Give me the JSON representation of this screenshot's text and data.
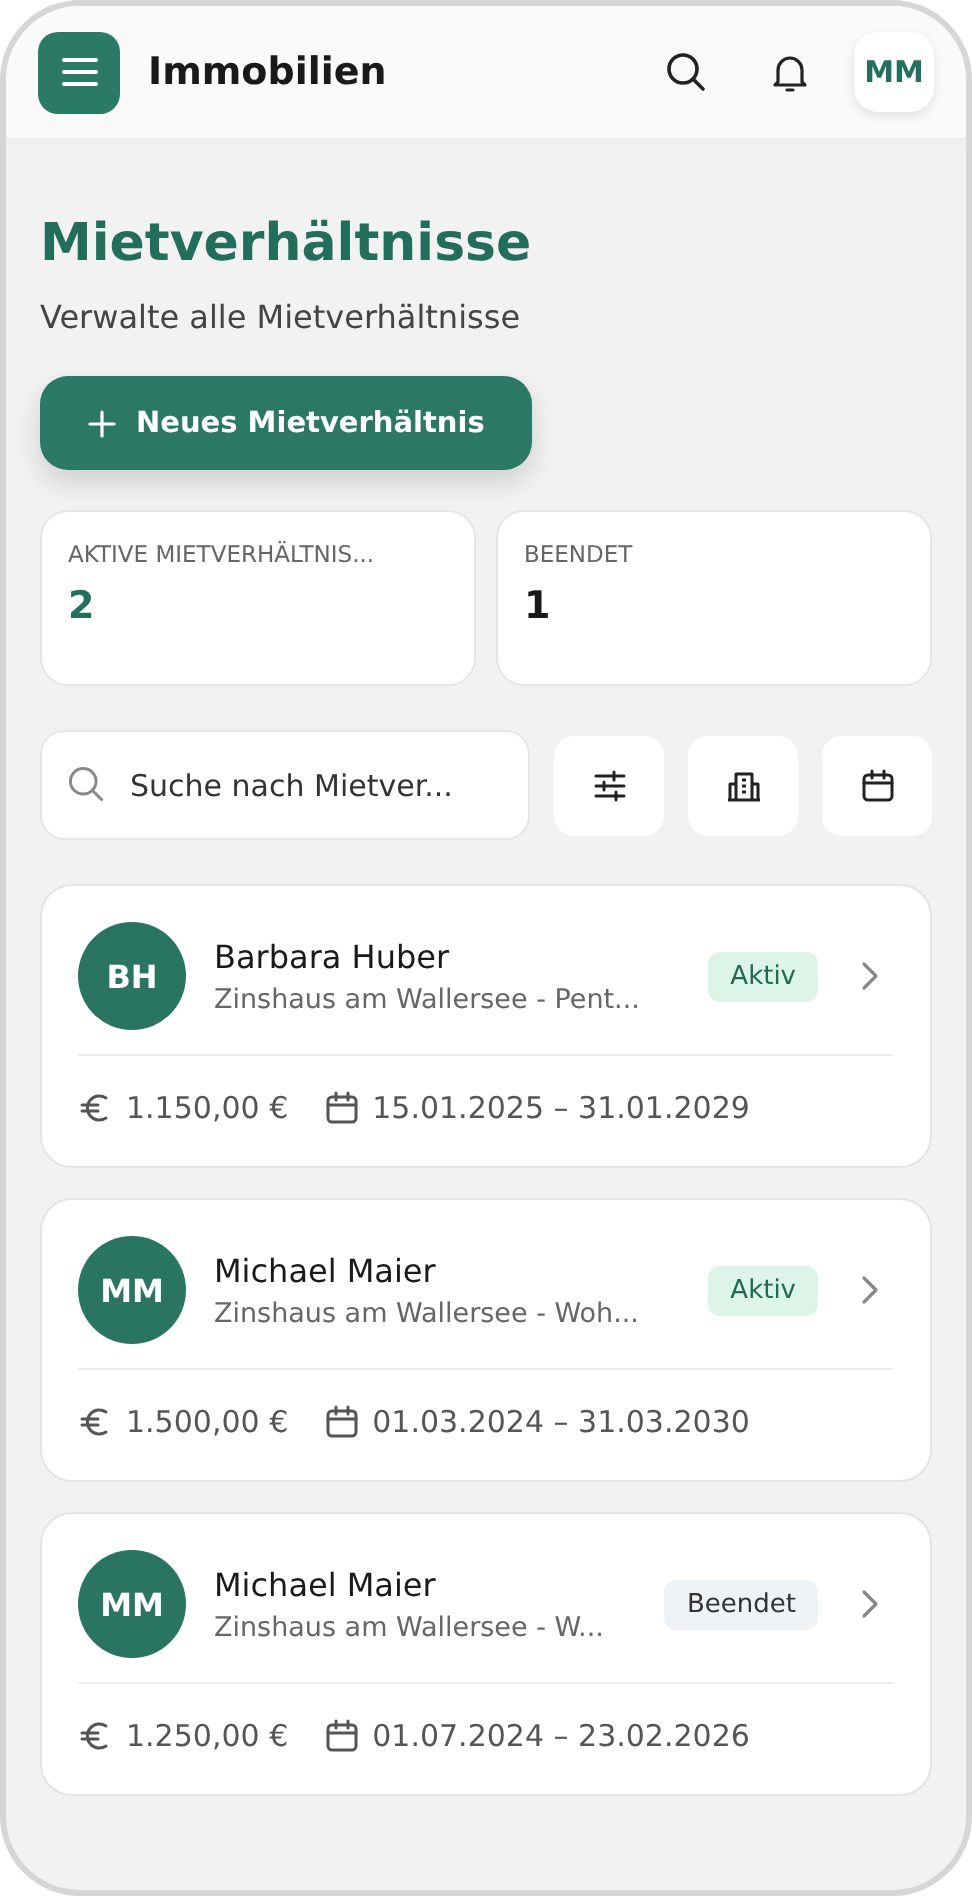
{
  "header": {
    "title": "Immobilien",
    "avatar": "MM"
  },
  "page": {
    "title": "Mietverhältnisse",
    "subtitle": "Verwalte alle Mietverhältnisse",
    "new_button": "Neues Mietverhältnis"
  },
  "stats": [
    {
      "label": "AKTIVE MIETVERHÄLTNIS...",
      "value": "2",
      "kind": "accent"
    },
    {
      "label": "BEENDET",
      "value": "1",
      "kind": "plain"
    }
  ],
  "search": {
    "placeholder": "Suche nach Mietver..."
  },
  "tenancies": [
    {
      "initials": "BH",
      "name": "Barbara Huber",
      "property": "Zinshaus am Wallersee - Pent...",
      "status": "Aktiv",
      "kind": "active",
      "rent": "1.150,00 €",
      "period": "15.01.2025 – 31.01.2029"
    },
    {
      "initials": "MM",
      "name": "Michael Maier",
      "property": "Zinshaus am Wallersee - Woh...",
      "status": "Aktiv",
      "kind": "active",
      "rent": "1.500,00 €",
      "period": "01.03.2024 – 31.03.2030"
    },
    {
      "initials": "MM",
      "name": "Michael Maier",
      "property": "Zinshaus am Wallersee - W...",
      "status": "Beendet",
      "kind": "ended",
      "rent": "1.250,00 €",
      "period": "01.07.2024 – 23.02.2026"
    }
  ]
}
